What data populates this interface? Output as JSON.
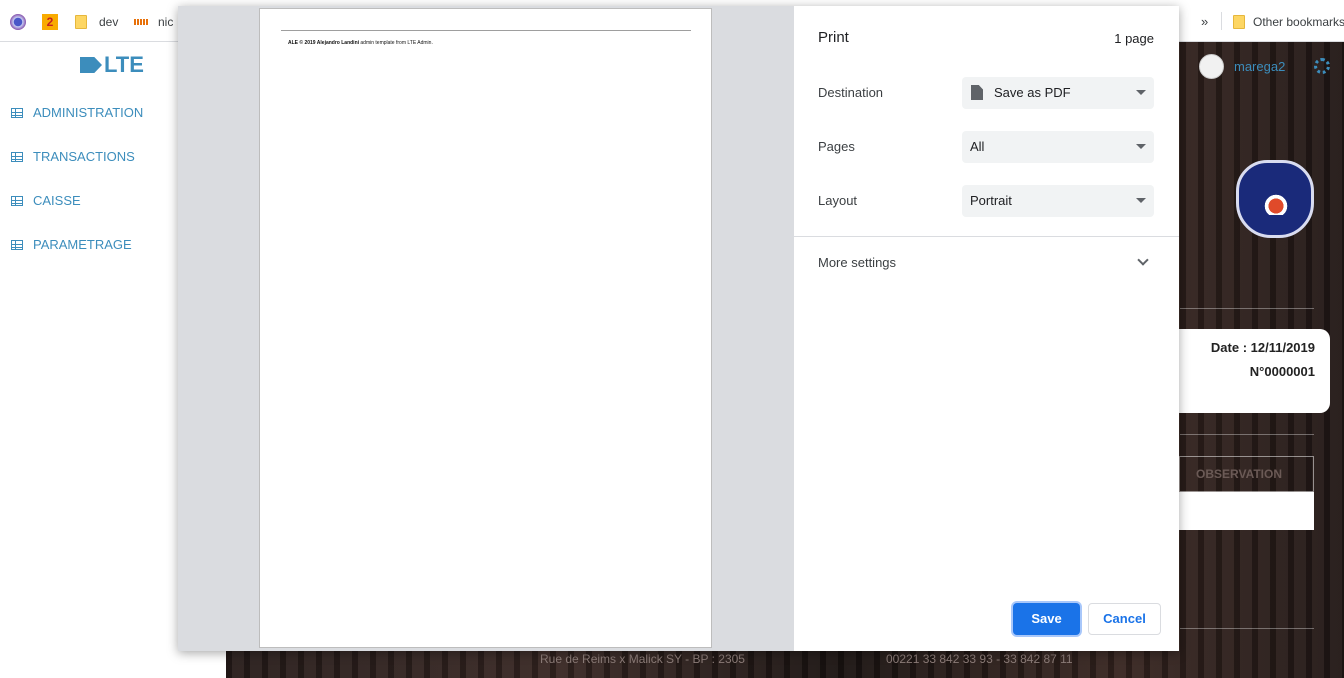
{
  "bookmarks": {
    "items": [
      {
        "label": ""
      },
      {
        "label": "2"
      },
      {
        "label": "dev"
      },
      {
        "label": "nic"
      }
    ],
    "more_label": "»",
    "other_bookmarks_label": "Other bookmarks"
  },
  "app": {
    "logo_text": "LTE",
    "nav": [
      {
        "label": "ADMINISTRATION",
        "icon": "table-icon"
      },
      {
        "label": "TRANSACTIONS",
        "icon": "table-icon"
      },
      {
        "label": "CAISSE",
        "icon": "table-icon"
      },
      {
        "label": "PARAMETRAGE",
        "icon": "table-icon"
      }
    ],
    "user_name": "marega2",
    "date_text": "Date : 12/11/2019",
    "number_text": "N°0000001",
    "table_header": "OBSERVATION",
    "footer_address": "Rue de Reims x Malick SY - BP : 2305",
    "footer_phones": "00221 33 842 33 93 - 33 842 87 11",
    "accent_color": "#3c8dbc"
  },
  "print_dialog": {
    "title": "Print",
    "page_count": "1 page",
    "destination_label": "Destination",
    "destination_value": "Save as PDF",
    "pages_label": "Pages",
    "pages_value": "All",
    "layout_label": "Layout",
    "layout_value": "Portrait",
    "more_settings_label": "More settings",
    "save_label": "Save",
    "cancel_label": "Cancel",
    "preview": {
      "footer_bold": "ALE © 2019 Alejandro Landini",
      "footer_rest": " admin template from LTE Admin."
    },
    "primary_color": "#1a73e8"
  }
}
